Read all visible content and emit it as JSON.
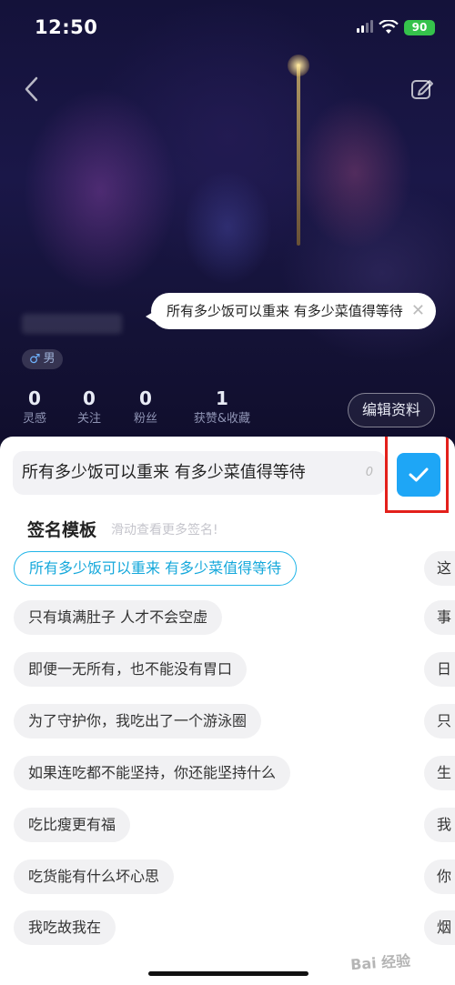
{
  "status_bar": {
    "time": "12:50",
    "battery": "90"
  },
  "profile": {
    "gender": "男",
    "stats": [
      {
        "value": "0",
        "label": "灵感"
      },
      {
        "value": "0",
        "label": "关注"
      },
      {
        "value": "0",
        "label": "粉丝"
      },
      {
        "value": "1",
        "label": "获赞&收藏"
      }
    ],
    "edit_button": "编辑资料"
  },
  "tooltip": {
    "text": "所有多少饭可以重来 有多少菜值得等待"
  },
  "signature_editor": {
    "input_value": "所有多少饭可以重来 有多少菜值得等待",
    "char_count": "0",
    "templates_title": "签名模板",
    "templates_hint": "滑动查看更多签名!",
    "templates_col1": [
      "所有多少饭可以重来 有多少菜值得等待",
      "只有填满肚子 人才不会空虚",
      "即便一无所有，也不能没有胃口",
      "为了守护你，我吃出了一个游泳圈",
      "如果连吃都不能坚持，你还能坚持什么",
      "吃比瘦更有福",
      "吃货能有什么坏心思",
      "我吃故我在"
    ],
    "templates_col2": [
      "这",
      "事",
      "日",
      "只",
      "生",
      "我",
      "你",
      "烟"
    ],
    "selected_index": 0
  },
  "watermark": "Bai 经验",
  "colors": {
    "accent": "#1ea6f6",
    "highlight_frame": "#e3201b",
    "chip_active": "#21b5e8"
  }
}
